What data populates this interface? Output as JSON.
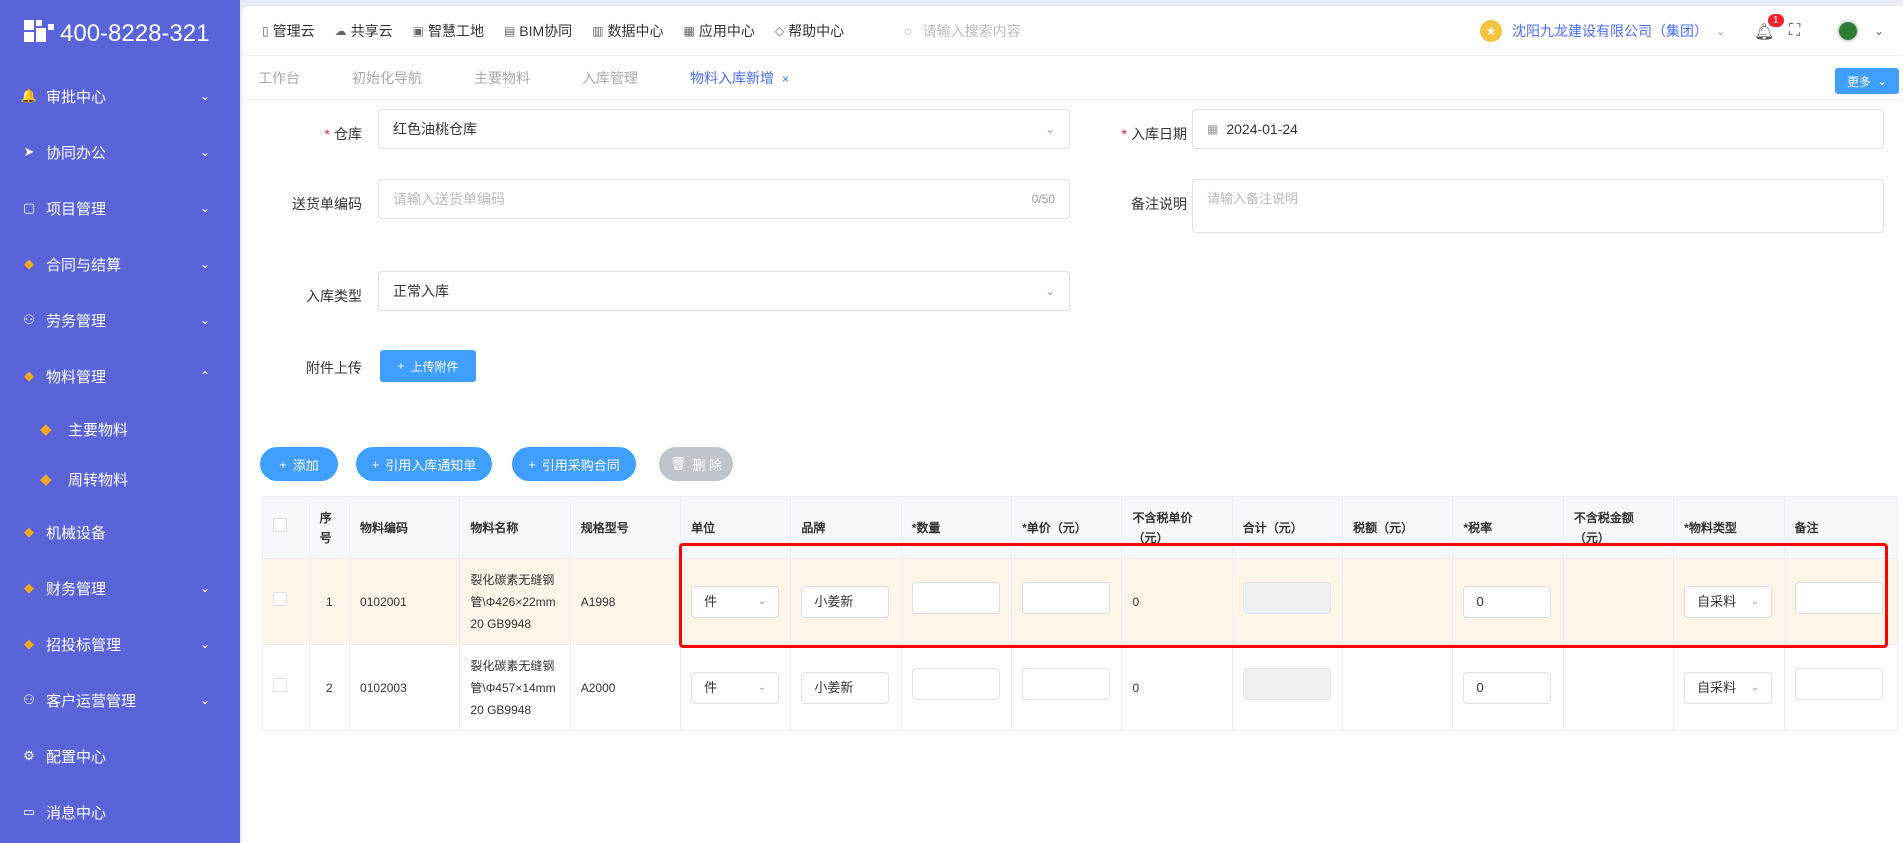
{
  "sidebar": {
    "phone": "400-8228-321",
    "items": [
      {
        "icon": "bell-icon",
        "glyph": "🔔",
        "label": "审批中心",
        "chevron": "⌄"
      },
      {
        "icon": "send-icon",
        "glyph": "➤",
        "label": "协同办公",
        "chevron": "⌄"
      },
      {
        "icon": "book-icon",
        "glyph": "▢",
        "label": "项目管理",
        "chevron": "⌄"
      },
      {
        "icon": "gem-icon",
        "glyph": "◆",
        "label": "合同与结算",
        "chevron": "⌄"
      },
      {
        "icon": "person-icon",
        "glyph": "⚇",
        "label": "劳务管理",
        "chevron": "⌄"
      },
      {
        "icon": "gem-icon",
        "glyph": "◆",
        "label": "物料管理",
        "chevron": "⌃"
      },
      {
        "icon": "gem-icon",
        "glyph": "◆",
        "label": "主要物料",
        "sub": true
      },
      {
        "icon": "gem-icon",
        "glyph": "◆",
        "label": "周转物料",
        "sub": true
      },
      {
        "icon": "gem-icon",
        "glyph": "◆",
        "label": "机械设备",
        "chevron": ""
      },
      {
        "icon": "gem-icon",
        "glyph": "◆",
        "label": "财务管理",
        "chevron": "⌄"
      },
      {
        "icon": "gem-icon",
        "glyph": "◆",
        "label": "招投标管理",
        "chevron": "⌄"
      },
      {
        "icon": "person-icon",
        "glyph": "⚇",
        "label": "客户运营管理",
        "chevron": "⌄"
      },
      {
        "icon": "gear-icon",
        "glyph": "⚙",
        "label": "配置中心",
        "chevron": ""
      },
      {
        "icon": "message-icon",
        "glyph": "▭",
        "label": "消息中心",
        "chevron": ""
      }
    ]
  },
  "topnav": {
    "links": [
      {
        "icon": "doc-icon",
        "glyph": "▯",
        "label": "管理云"
      },
      {
        "icon": "cloud-icon",
        "glyph": "☁",
        "label": "共享云"
      },
      {
        "icon": "site-icon",
        "glyph": "▣",
        "label": "智慧工地"
      },
      {
        "icon": "bim-icon",
        "glyph": "▤",
        "label": "BIM协同"
      },
      {
        "icon": "chart-icon",
        "glyph": "▥",
        "label": "数据中心"
      },
      {
        "icon": "apps-icon",
        "glyph": "▦",
        "label": "应用中心"
      },
      {
        "icon": "help-icon",
        "glyph": "◇",
        "label": "帮助中心"
      }
    ],
    "search_placeholder": "请输入搜索内容",
    "company": "沈阳九龙建设有限公司（集团）",
    "notify_count": "1"
  },
  "tabs": [
    {
      "label": "工作台",
      "active": false
    },
    {
      "label": "初始化导航",
      "active": false
    },
    {
      "label": "主要物料",
      "active": false
    },
    {
      "label": "入库管理",
      "active": false
    },
    {
      "label": "物料入库新增",
      "active": true,
      "close": "×"
    }
  ],
  "more_label": "更多",
  "form": {
    "warehouse_label": "仓库",
    "warehouse_value": "红色油桃仓库",
    "date_label": "入库日期",
    "date_value": "2024-01-24",
    "delivery_label": "送货单编码",
    "delivery_placeholder": "请输入送货单编码",
    "delivery_count": "0/50",
    "remark_label": "备注说明",
    "remark_placeholder": "请输入备注说明",
    "type_label": "入库类型",
    "type_value": "正常入库",
    "attach_label": "附件上传",
    "upload_btn": "上传附件"
  },
  "actions": {
    "add": "添加",
    "ref_notice": "引用入库通知单",
    "ref_contract": "引用采购合同",
    "delete": "删 除"
  },
  "table": {
    "headers": [
      "序号",
      "物料编码",
      "物料名称",
      "规格型号",
      "单位",
      "品牌",
      "*数量",
      "*单价（元）",
      "不含税单价（元）",
      "合计（元）",
      "税额（元）",
      "*税率",
      "不含税金额（元）",
      "*物料类型",
      "备注"
    ],
    "rows": [
      {
        "seq": "1",
        "code": "0102001",
        "name": "裂化碳素无缝钢管\\Φ426×22mm 20 GB9948",
        "spec": "A1998",
        "unit": "件",
        "brand": "小姜新",
        "qty": "",
        "price": "",
        "price_notax": "0",
        "tax_rate": "0",
        "type": "自采料",
        "remark": ""
      },
      {
        "seq": "2",
        "code": "0102003",
        "name": "裂化碳素无缝钢管\\Φ457×14mm 20 GB9948",
        "spec": "A2000",
        "unit": "件",
        "brand": "小姜新",
        "qty": "",
        "price": "",
        "price_notax": "0",
        "tax_rate": "0",
        "type": "自采料",
        "remark": ""
      }
    ]
  },
  "colors": {
    "sidebar": "#5a63d8",
    "primary": "#409eff",
    "highlight_row": "#fdf5e8",
    "annotation": "#ff0000"
  }
}
